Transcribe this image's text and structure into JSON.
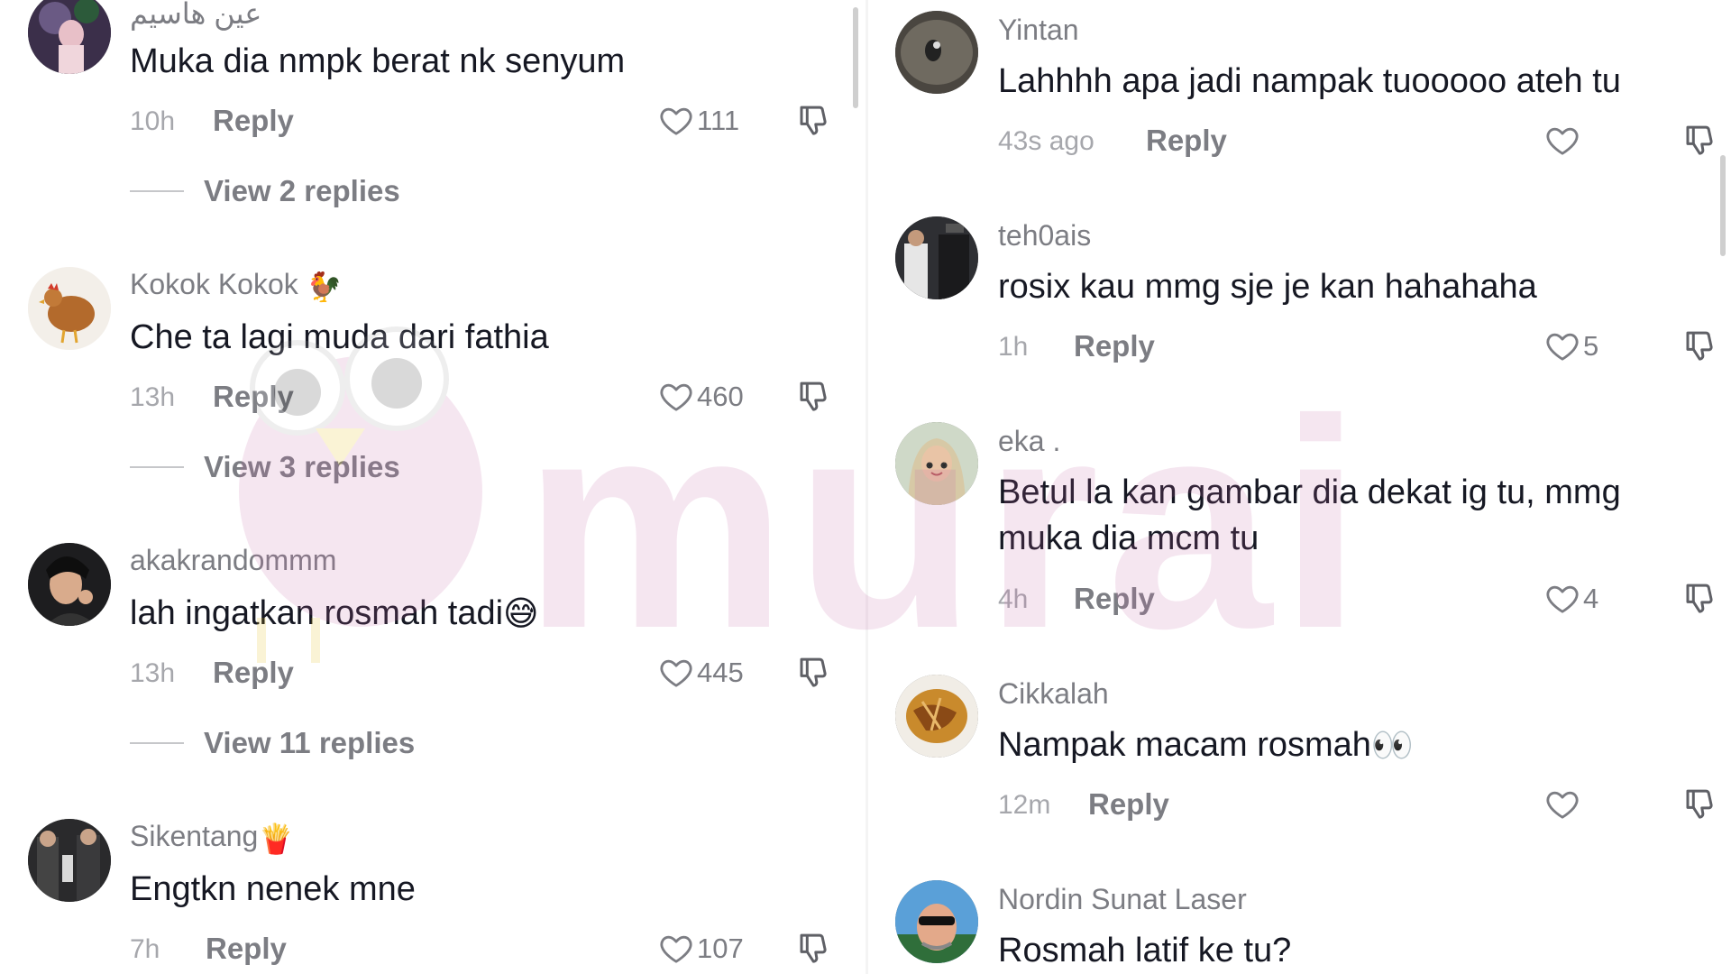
{
  "left_comments": [
    {
      "username": "عين هاسيم",
      "text": "Muka dia nmpk berat nk senyum",
      "time": "10h",
      "reply_label": "Reply",
      "likes": "111",
      "view_replies": "View 2 replies"
    },
    {
      "username": "Kokok Kokok",
      "username_emoji": "🐓",
      "text": "Che ta lagi muda dari fathia",
      "time": "13h",
      "reply_label": "Reply",
      "likes": "460",
      "view_replies": "View 3 replies"
    },
    {
      "username": "akakrandommm",
      "text": "lah ingatkan rosmah tadi",
      "text_emoji": "😅",
      "time": "13h",
      "reply_label": "Reply",
      "likes": "445",
      "view_replies": "View 11 replies"
    },
    {
      "username": "Sikentang",
      "username_emoji": "🍟",
      "text": "Engtkn nenek mne",
      "time": "7h",
      "reply_label": "Reply",
      "likes": "107"
    }
  ],
  "right_comments": [
    {
      "username": "Yintan",
      "text": "Lahhhh apa jadi nampak tuooooo ateh tu",
      "time": "43s ago",
      "reply_label": "Reply",
      "likes": ""
    },
    {
      "username": "teh0ais",
      "text": "rosix kau mmg sje je kan hahahaha",
      "time": "1h",
      "reply_label": "Reply",
      "likes": "5"
    },
    {
      "username": "eka .",
      "text": "Betul la kan gambar dia dekat ig tu, mmg muka dia mcm tu",
      "time": "4h",
      "reply_label": "Reply",
      "likes": "4"
    },
    {
      "username": "Cikkalah",
      "text": "Nampak macam rosmah",
      "text_emoji": "👀",
      "time": "12m",
      "reply_label": "Reply",
      "likes": ""
    },
    {
      "username": "Nordin Sunat Laser",
      "text": "Rosmah latif ke tu?"
    }
  ],
  "watermark": {
    "text": "murai"
  },
  "icons": {
    "like": "heart-outline-icon",
    "dislike": "thumbs-down-icon"
  },
  "colors": {
    "text_primary": "#161823",
    "text_secondary": "#7c7d83",
    "text_muted": "#a6a7ac",
    "watermark_pink": "#d6a8c8"
  }
}
